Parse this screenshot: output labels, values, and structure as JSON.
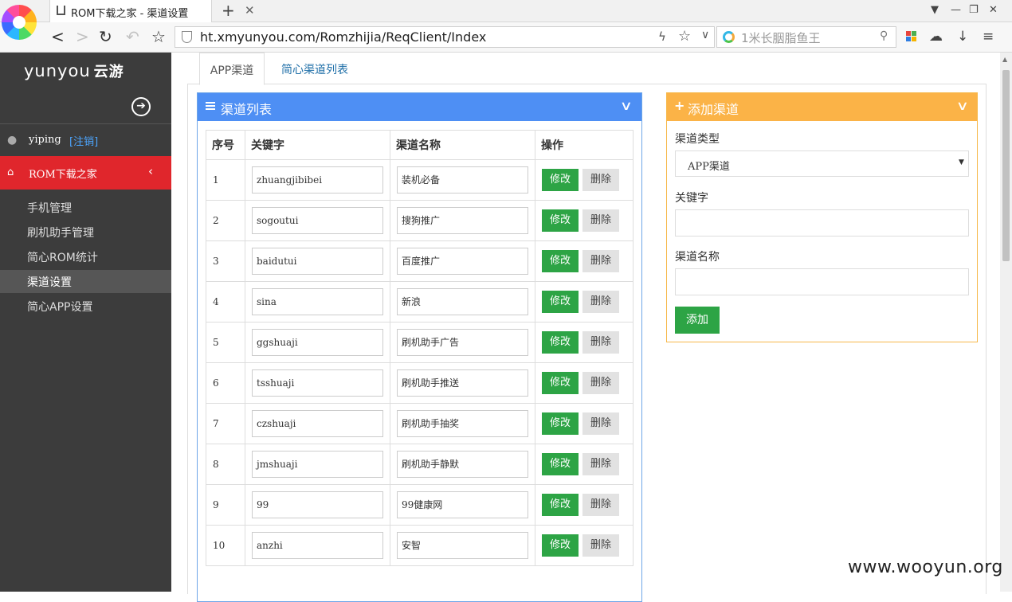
{
  "browser": {
    "tab_title": "ROM下载之家 - 渠道设置",
    "url": "ht.xmyunyou.com/Romzhijia/ReqClient/Index",
    "search_placeholder": "1米长胭脂鱼王"
  },
  "sidebar": {
    "brand_latin": "yunyou",
    "brand_cn": "云游",
    "user": "yiping",
    "logout": "[注销]",
    "section": "ROM下载之家",
    "items": [
      {
        "label": "手机管理"
      },
      {
        "label": "刷机助手管理"
      },
      {
        "label": "简心ROM统计"
      },
      {
        "label": "渠道设置"
      },
      {
        "label": "简心APP设置"
      }
    ]
  },
  "tabs": [
    {
      "label": "APP渠道"
    },
    {
      "label": "简心渠道列表"
    }
  ],
  "list_panel": {
    "title": "渠道列表",
    "columns": [
      "序号",
      "关键字",
      "渠道名称",
      "操作"
    ],
    "edit_label": "修改",
    "delete_label": "删除",
    "rows": [
      {
        "no": "1",
        "keyword": "zhuangjibibei",
        "name": "装机必备"
      },
      {
        "no": "2",
        "keyword": "sogoutui",
        "name": "搜狗推广"
      },
      {
        "no": "3",
        "keyword": "baidutui",
        "name": "百度推广"
      },
      {
        "no": "4",
        "keyword": "sina",
        "name": "新浪"
      },
      {
        "no": "5",
        "keyword": "ggshuaji",
        "name": "刷机助手广告"
      },
      {
        "no": "6",
        "keyword": "tsshuaji",
        "name": "刷机助手推送"
      },
      {
        "no": "7",
        "keyword": "czshuaji",
        "name": "刷机助手抽奖"
      },
      {
        "no": "8",
        "keyword": "jmshuaji",
        "name": "刷机助手静默"
      },
      {
        "no": "9",
        "keyword": "99",
        "name": "99健康网"
      },
      {
        "no": "10",
        "keyword": "anzhi",
        "name": "安智"
      }
    ]
  },
  "add_panel": {
    "title": "添加渠道",
    "type_label": "渠道类型",
    "type_value": "APP渠道",
    "keyword_label": "关键字",
    "name_label": "渠道名称",
    "add_button": "添加"
  },
  "watermark": "www.wooyun.org",
  "colors": {
    "sidebar_bg": "#3c3c3c",
    "sidebar_active": "#e0262c",
    "list_header": "#4e8ff4",
    "add_header": "#fbb347",
    "edit_button": "#2da445"
  }
}
